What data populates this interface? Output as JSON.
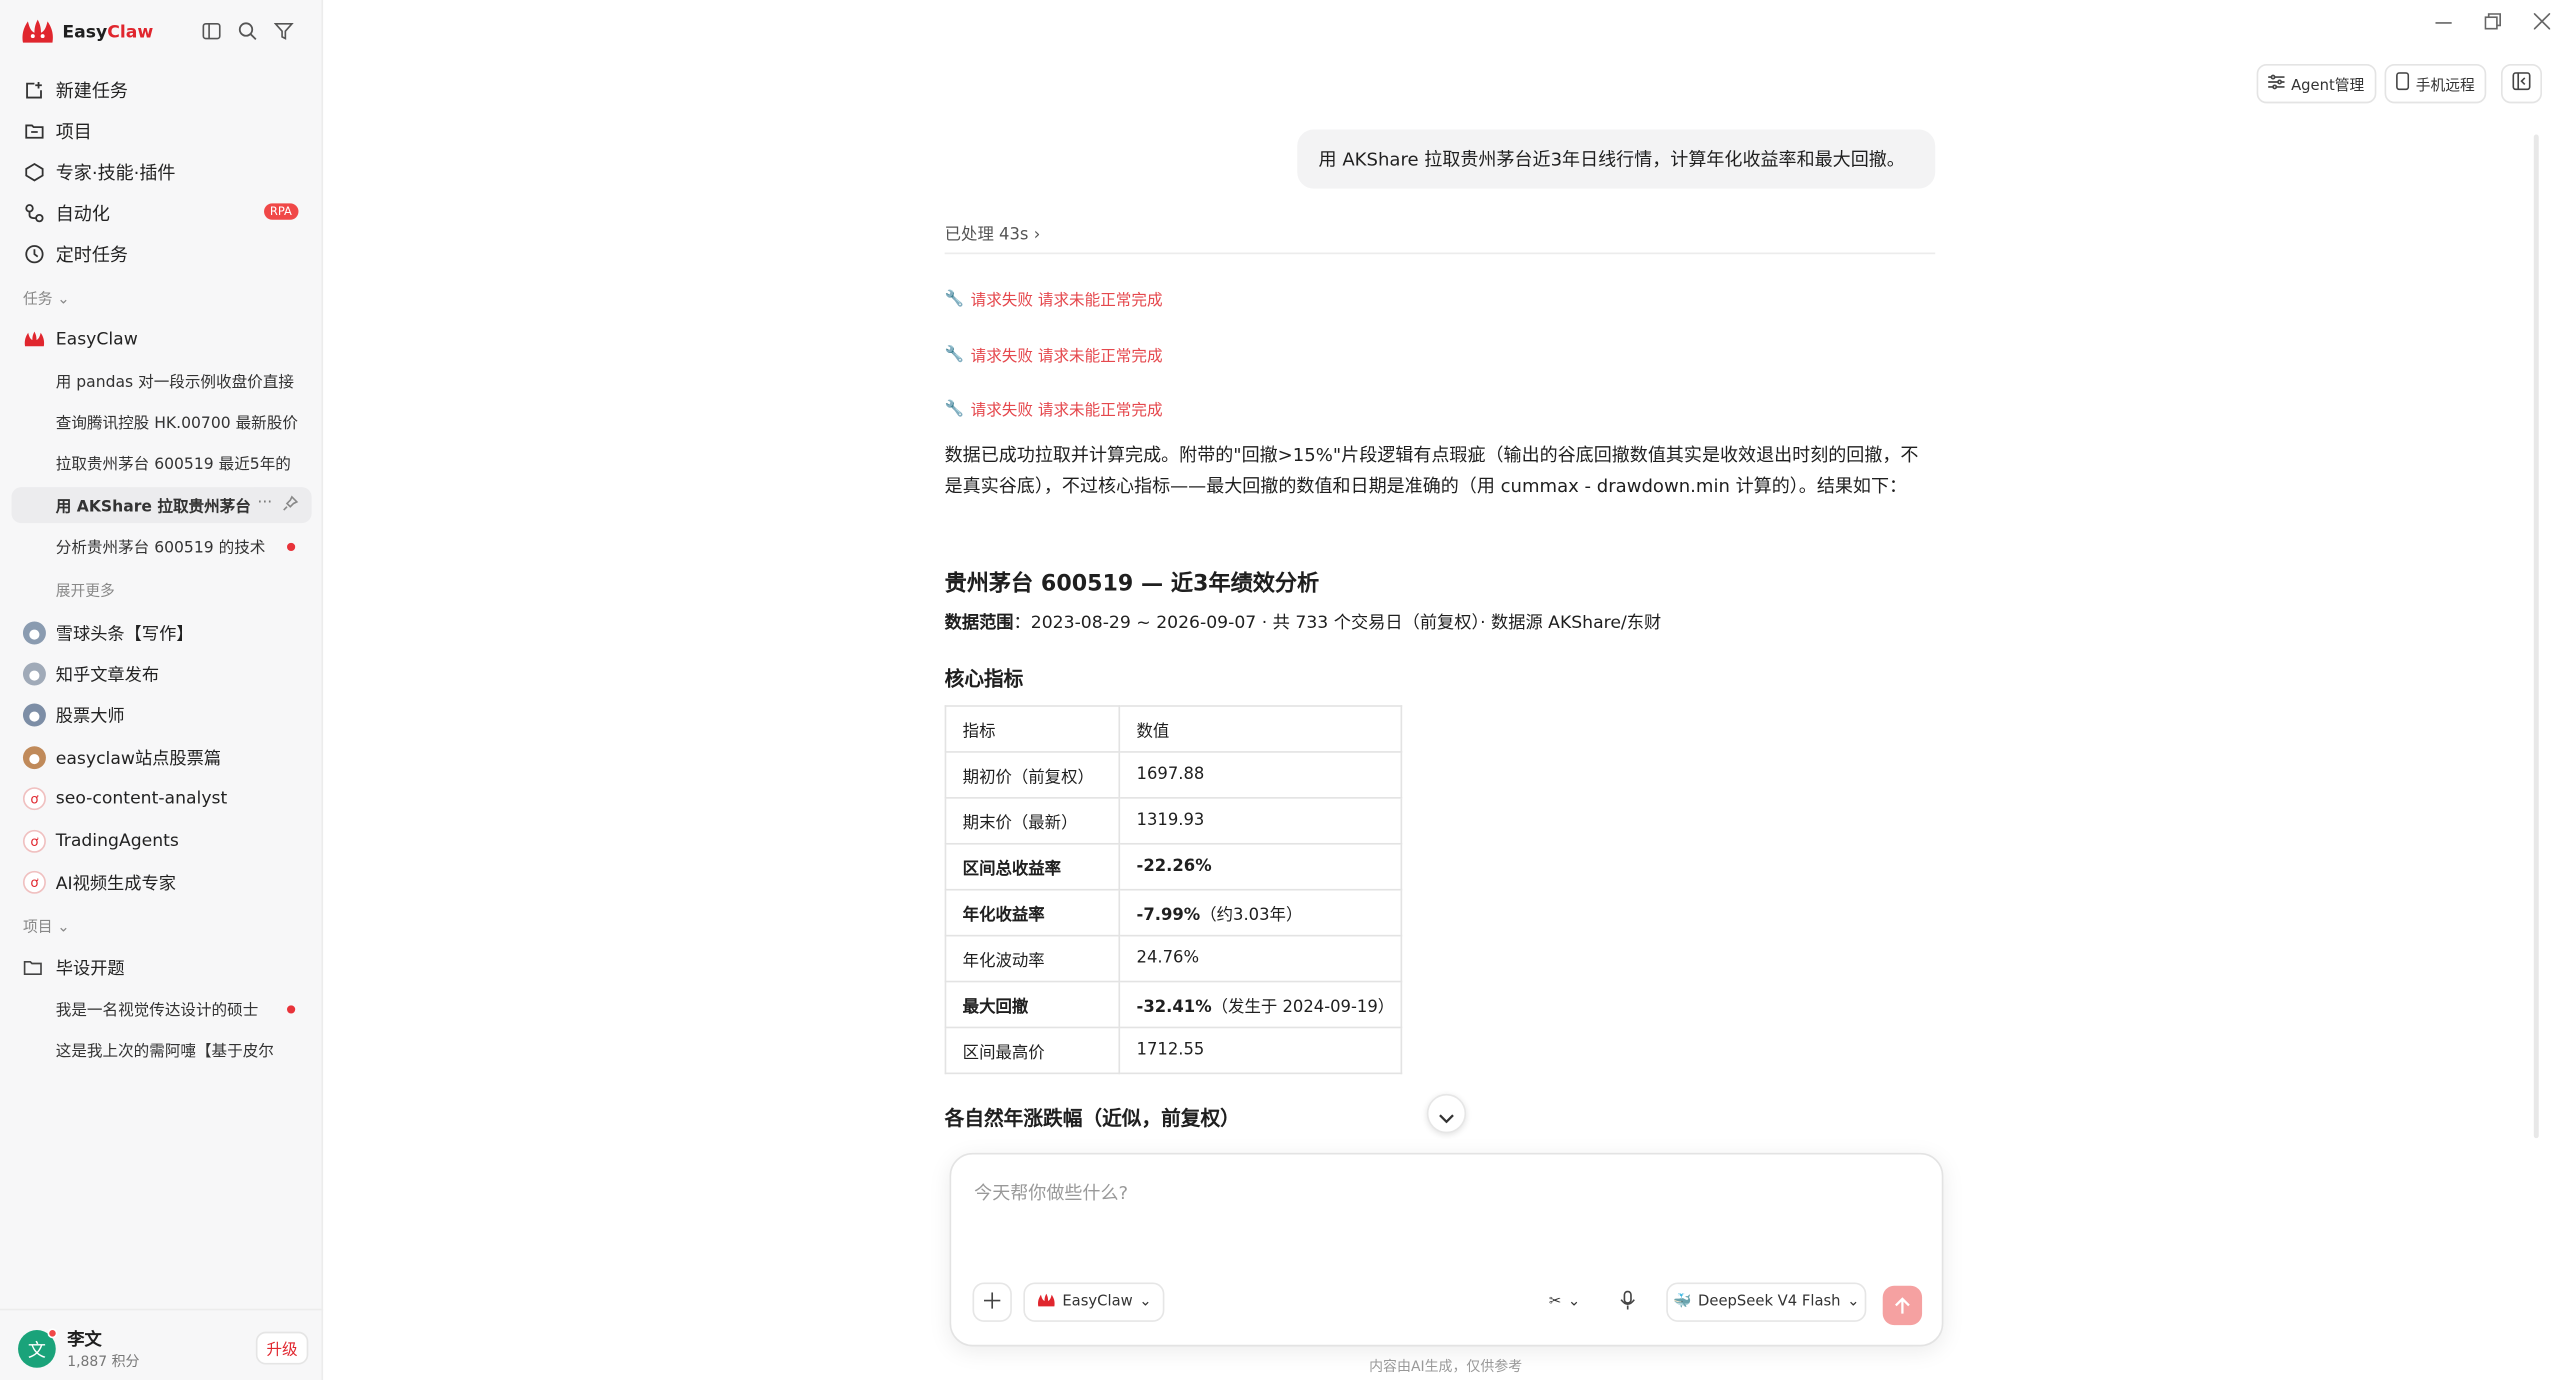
{
  "app": {
    "name_a": "Easy",
    "name_b": "Claw"
  },
  "nav": [
    {
      "label": "新建任务",
      "icon": "new-task-icon"
    },
    {
      "label": "项目",
      "icon": "folder-icon"
    },
    {
      "label": "专家·技能·插件",
      "icon": "puzzle-icon"
    },
    {
      "label": "自动化",
      "icon": "automation-icon",
      "badge": "RPA"
    },
    {
      "label": "定时任务",
      "icon": "clock-icon"
    }
  ],
  "sections": {
    "tasks": "任务",
    "projects": "项目"
  },
  "task_group": {
    "name": "EasyClaw",
    "items": [
      "用 pandas 对一段示例收盘价直接",
      "查询腾讯控股 HK.00700 最新股价",
      "拉取贵州茅台 600519 最近5年的",
      "用 AKShare 拉取贵州茅台",
      "分析贵州茅台 600519 的技术"
    ],
    "more": "展开更多"
  },
  "agents": [
    "雪球头条【写作】",
    "知乎文章发布",
    "股票大师",
    "easyclaw站点股票篇",
    "seo-content-analyst",
    "TradingAgents",
    "AI视频生成专家"
  ],
  "project": {
    "name": "毕设开题",
    "items": [
      "我是一名视觉传达设计的硕士",
      "这是我上次的需阿嚏【基于皮尔"
    ]
  },
  "user": {
    "avatar": "文",
    "name": "李文",
    "points": "1,887 积分",
    "upgrade": "升级"
  },
  "toolbar": {
    "agent_mgmt": "Agent管理",
    "remote": "手机远程"
  },
  "chat": {
    "user_message": "用 AKShare 拉取贵州茅台近3年日线行情，计算年化收益率和最大回撤。",
    "processed": "已处理 43s",
    "errors": [
      "请求失败 请求未能正常完成",
      "请求失败 请求未能正常完成",
      "请求失败 请求未能正常完成"
    ],
    "answer": "数据已成功拉取并计算完成。附带的\"回撤>15%\"片段逻辑有点瑕疵（输出的谷底回撤数值其实是收效退出时刻的回撤，不是真实谷底），不过核心指标——最大回撤的数值和日期是准确的（用 cummax - drawdown.min 计算的）。结果如下：",
    "heading": "贵州茅台 600519 — 近3年绩效分析",
    "range_label": "数据范围",
    "range_text": "：2023-08-29 ~ 2026-09-07 · 共 733 个交易日（前复权）· 数据源 AKShare/东财",
    "core_title": "核心指标",
    "table": {
      "headers": [
        "指标",
        "数值"
      ],
      "rows": [
        {
          "k": "期初价（前复权）",
          "v": "1697.88",
          "bold": false,
          "note": ""
        },
        {
          "k": "期末价（最新）",
          "v": "1319.93",
          "bold": false,
          "note": ""
        },
        {
          "k": "区间总收益率",
          "v": "-22.26%",
          "bold": true,
          "note": ""
        },
        {
          "k": "年化收益率",
          "v": "-7.99%",
          "bold": true,
          "note": "（约3.03年）"
        },
        {
          "k": "年化波动率",
          "v": "24.76%",
          "bold": false,
          "note": ""
        },
        {
          "k": "最大回撤",
          "v": "-32.41%",
          "bold": true,
          "note": "（发生于 2024-09-19）"
        },
        {
          "k": "区间最高价",
          "v": "1712.55",
          "bold": false,
          "note": ""
        }
      ]
    },
    "next_heading": "各自然年涨跌幅（近似，前复权）"
  },
  "composer": {
    "placeholder": "今天帮你做些什么?",
    "agent": "EasyClaw",
    "model": "DeepSeek V4 Flash"
  },
  "footer": "内容由AI生成，仅供参考"
}
